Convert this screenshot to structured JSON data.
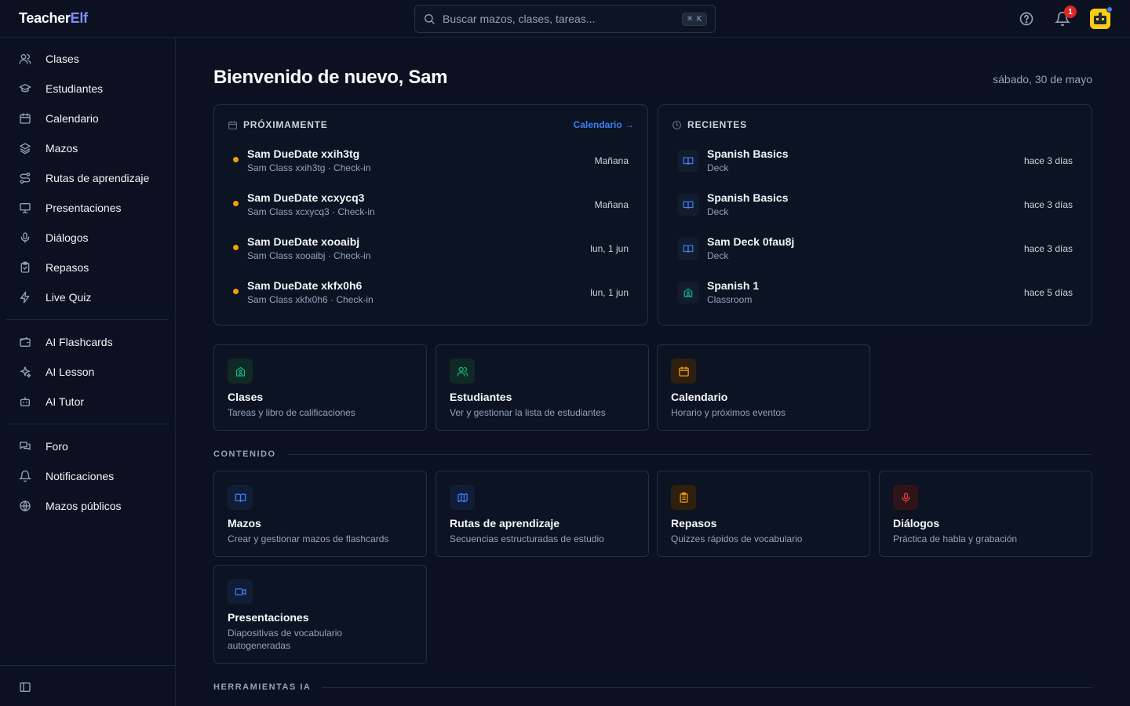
{
  "app": {
    "logo_main": "Teacher",
    "logo_accent": "Elf"
  },
  "search": {
    "placeholder": "Buscar mazos, clases, tareas...",
    "shortcut": "⌘ K"
  },
  "header": {
    "notifications_count": "1"
  },
  "sidebar": {
    "group1": [
      {
        "label": "Clases",
        "icon": "users-icon"
      },
      {
        "label": "Estudiantes",
        "icon": "graduation-cap-icon"
      },
      {
        "label": "Calendario",
        "icon": "calendar-icon"
      },
      {
        "label": "Mazos",
        "icon": "layers-icon"
      },
      {
        "label": "Rutas de aprendizaje",
        "icon": "route-icon"
      },
      {
        "label": "Presentaciones",
        "icon": "presentation-icon"
      },
      {
        "label": "Diálogos",
        "icon": "mic-icon"
      },
      {
        "label": "Repasos",
        "icon": "clipboard-check-icon"
      },
      {
        "label": "Live Quiz",
        "icon": "zap-icon"
      }
    ],
    "group2": [
      {
        "label": "AI Flashcards",
        "icon": "wallet-icon"
      },
      {
        "label": "AI Lesson",
        "icon": "sparkles-icon"
      },
      {
        "label": "AI Tutor",
        "icon": "bot-icon"
      }
    ],
    "group3": [
      {
        "label": "Foro",
        "icon": "messages-icon"
      },
      {
        "label": "Notificaciones",
        "icon": "bell-icon"
      },
      {
        "label": "Mazos públicos",
        "icon": "globe-icon"
      }
    ]
  },
  "main": {
    "welcome": "Bienvenido de nuevo, Sam",
    "date": "sábado, 30 de mayo",
    "upcoming": {
      "title": "PRÓXIMAMENTE",
      "link": "Calendario →",
      "items": [
        {
          "title": "Sam DueDate xxih3tg",
          "subtitle": "Sam Class xxih3tg · Check-in",
          "when": "Mañana"
        },
        {
          "title": "Sam DueDate xcxycq3",
          "subtitle": "Sam Class xcxycq3 · Check-in",
          "when": "Mañana"
        },
        {
          "title": "Sam DueDate xooaibj",
          "subtitle": "Sam Class xooaibj · Check-in",
          "when": "lun, 1 jun"
        },
        {
          "title": "Sam DueDate xkfx0h6",
          "subtitle": "Sam Class xkfx0h6 · Check-in",
          "when": "lun, 1 jun"
        }
      ]
    },
    "recent": {
      "title": "RECIENTES",
      "items": [
        {
          "title": "Spanish Basics",
          "subtitle": "Deck",
          "when": "hace 3 días",
          "icon": "book-open-icon"
        },
        {
          "title": "Spanish Basics",
          "subtitle": "Deck",
          "when": "hace 3 días",
          "icon": "book-open-icon"
        },
        {
          "title": "Sam Deck 0fau8j",
          "subtitle": "Deck",
          "when": "hace 3 días",
          "icon": "book-open-icon"
        },
        {
          "title": "Spanish 1",
          "subtitle": "Classroom",
          "when": "hace 5 días",
          "icon": "school-icon"
        }
      ]
    },
    "quick": [
      {
        "title": "Clases",
        "desc": "Tareas y libro de calificaciones",
        "icon": "school-icon"
      },
      {
        "title": "Estudiantes",
        "desc": "Ver y gestionar la lista de estudiantes",
        "icon": "users-icon"
      },
      {
        "title": "Calendario",
        "desc": "Horario y próximos eventos",
        "icon": "calendar-icon"
      }
    ],
    "content_section": "CONTENIDO",
    "content": [
      {
        "title": "Mazos",
        "desc": "Crear y gestionar mazos de flashcards",
        "icon": "book-open-icon"
      },
      {
        "title": "Rutas de aprendizaje",
        "desc": "Secuencias estructuradas de estudio",
        "icon": "map-icon"
      },
      {
        "title": "Repasos",
        "desc": "Quizzes rápidos de vocabulario",
        "icon": "clipboard-icon"
      },
      {
        "title": "Diálogos",
        "desc": "Práctica de habla y grabación",
        "icon": "mic-icon"
      },
      {
        "title": "Presentaciones",
        "desc": "Diapositivas de vocabulario autogeneradas",
        "icon": "video-icon"
      }
    ],
    "ai_section": "HERRAMIENTAS IA"
  },
  "colors": {
    "background": "#0b1120",
    "accent": "#3b82f6",
    "brand_accent": "#818cf8",
    "upcoming_dot": "#f59e0b",
    "green": "#10b981",
    "orange": "#f59e0b",
    "red": "#ef4444"
  }
}
